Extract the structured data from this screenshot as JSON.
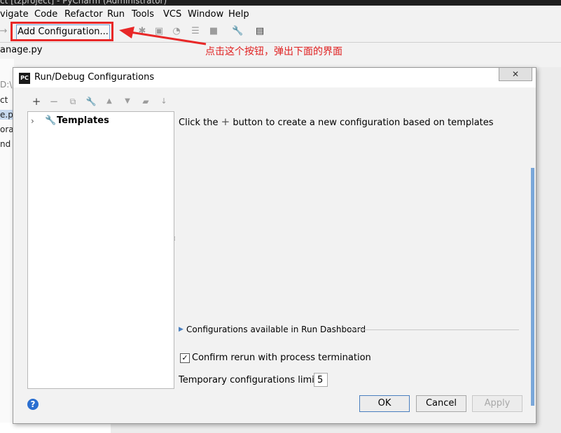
{
  "window_title": "ct [tzproject] - PyCharm (Administrator)",
  "menu": [
    "vigate",
    "Code",
    "Refactor",
    "Run",
    "Tools",
    "VCS",
    "Window",
    "Help"
  ],
  "toolbar": {
    "add_config_label": "Add Configuration..."
  },
  "annotation": "点击这个按钮，弹出下面的界面",
  "file_tab": "anage.py",
  "left_panel": [
    "D:\\p",
    "ct",
    "e.py",
    "orar",
    "nd"
  ],
  "dialog": {
    "title": "Run/Debug Configurations",
    "logo": "PC",
    "close_glyph": "✕",
    "tree": {
      "templates_label": "Templates"
    },
    "hint_prefix": "Click the",
    "hint_suffix": "button to create a new configuration based on templates",
    "dashboard_label": "Configurations available in Run Dashboard",
    "confirm_label": "Confirm rerun with process termination",
    "confirm_checked": true,
    "limit_label": "Temporary configurations limit:",
    "limit_value": "5",
    "help_glyph": "?",
    "ok_label": "OK",
    "cancel_label": "Cancel",
    "apply_label": "Apply"
  },
  "colors": {
    "highlight_red": "#e82828",
    "accent_blue": "#4a7fbf"
  }
}
